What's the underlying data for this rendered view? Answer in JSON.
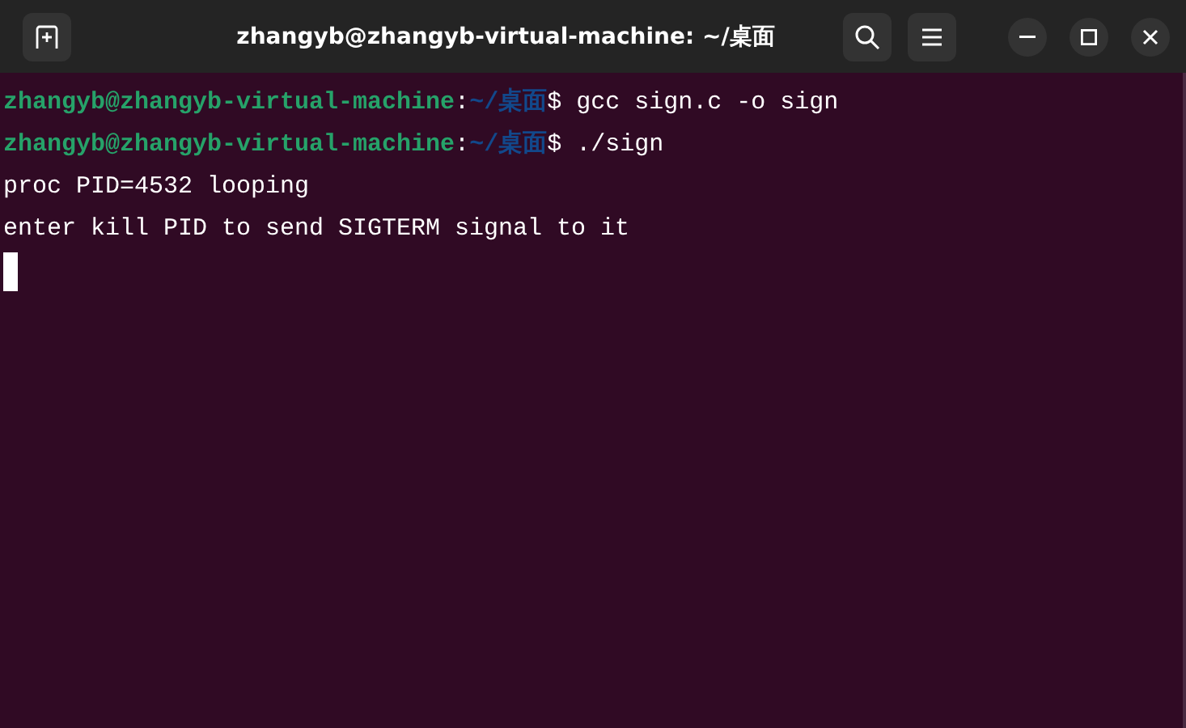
{
  "window": {
    "title": "zhangyb@zhangyb-virtual-machine: ~/桌面"
  },
  "lines": [
    {
      "kind": "prompt",
      "user_host": "zhangyb@zhangyb-virtual-machine",
      "separator": ":",
      "path": "~/桌面",
      "symbol": "$",
      "command": "gcc sign.c -o sign"
    },
    {
      "kind": "prompt",
      "user_host": "zhangyb@zhangyb-virtual-machine",
      "separator": ":",
      "path": "~/桌面",
      "symbol": "$",
      "command": "./sign"
    },
    {
      "kind": "output",
      "text": "proc PID=4532 looping"
    },
    {
      "kind": "output",
      "text": "enter kill PID to send SIGTERM signal to it"
    },
    {
      "kind": "cursor"
    }
  ]
}
